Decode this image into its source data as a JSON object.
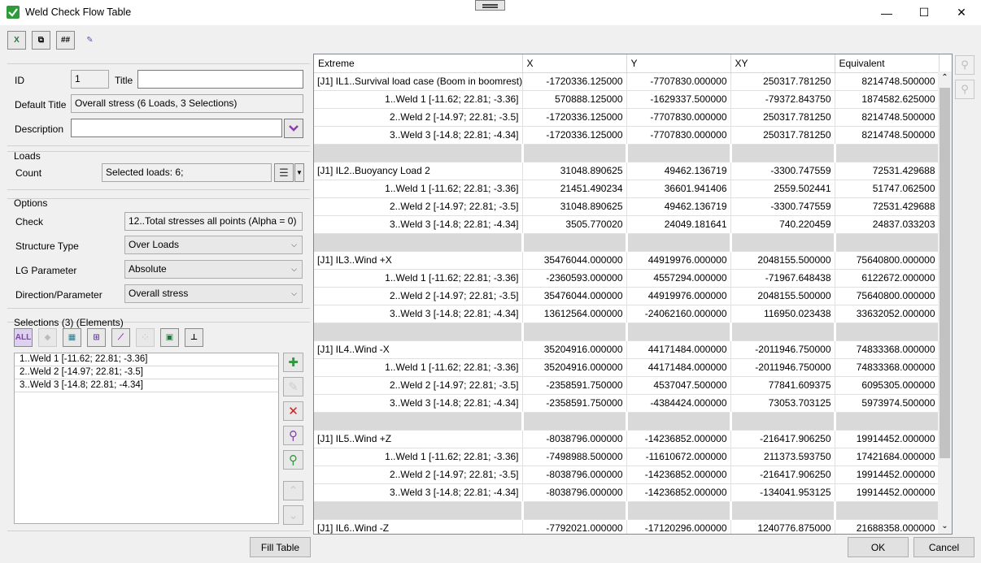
{
  "window": {
    "title": "Weld Check Flow Table",
    "minimize": "—",
    "maximize": "☐",
    "close": "✕"
  },
  "toolbar": {
    "export_label": "X",
    "copy_label": "⧉",
    "number_format_label": "##",
    "clear_label": "✎"
  },
  "form": {
    "id_label": "ID",
    "id_value": "1",
    "title_label": "Title",
    "title_value": "",
    "default_title_label": "Default Title",
    "default_title_value": "Overall stress (6 Loads, 3 Selections)",
    "description_label": "Description",
    "description_value": ""
  },
  "loads": {
    "group_label": "Loads",
    "count_label": "Count",
    "count_value": "Selected loads: 6;"
  },
  "options": {
    "group_label": "Options",
    "check_label": "Check",
    "check_value": "12..Total stresses all points (Alpha = 0)",
    "structure_type_label": "Structure Type",
    "structure_type_value": "Over Loads",
    "lg_parameter_label": "LG Parameter",
    "lg_parameter_value": "Absolute",
    "direction_label": "Direction/Parameter",
    "direction_value": "Overall stress"
  },
  "selections": {
    "group_label": "Selections (3) (Elements)",
    "all_label": "ALL",
    "items": [
      "1..Weld 1 [-11.62; 22.81; -3.36]",
      "2..Weld 2 [-14.97; 22.81; -3.5]",
      "3..Weld 3 [-14.8; 22.81; -4.34]"
    ]
  },
  "buttons": {
    "fill_table": "Fill Table",
    "ok": "OK",
    "cancel": "Cancel"
  },
  "table": {
    "headers": [
      "Extreme",
      "X",
      "Y",
      "XY",
      "Equivalent"
    ],
    "rows": [
      {
        "type": "main",
        "label": "[J1] IL1..Survival load case (Boom in boomrest)",
        "x": "-1720336.125000",
        "y": "-7707830.000000",
        "xy": "250317.781250",
        "eq": "8214748.500000"
      },
      {
        "type": "sub",
        "label": "1..Weld 1 [-11.62; 22.81; -3.36]",
        "x": "570888.125000",
        "y": "-1629337.500000",
        "xy": "-79372.843750",
        "eq": "1874582.625000"
      },
      {
        "type": "sub",
        "label": "2..Weld 2 [-14.97; 22.81; -3.5]",
        "x": "-1720336.125000",
        "y": "-7707830.000000",
        "xy": "250317.781250",
        "eq": "8214748.500000"
      },
      {
        "type": "sub",
        "label": "3..Weld 3 [-14.8; 22.81; -4.34]",
        "x": "-1720336.125000",
        "y": "-7707830.000000",
        "xy": "250317.781250",
        "eq": "8214748.500000"
      },
      {
        "type": "sep"
      },
      {
        "type": "main",
        "label": "[J1] IL2..Buoyancy Load 2",
        "x": "31048.890625",
        "y": "49462.136719",
        "xy": "-3300.747559",
        "eq": "72531.429688"
      },
      {
        "type": "sub",
        "label": "1..Weld 1 [-11.62; 22.81; -3.36]",
        "x": "21451.490234",
        "y": "36601.941406",
        "xy": "2559.502441",
        "eq": "51747.062500"
      },
      {
        "type": "sub",
        "label": "2..Weld 2 [-14.97; 22.81; -3.5]",
        "x": "31048.890625",
        "y": "49462.136719",
        "xy": "-3300.747559",
        "eq": "72531.429688"
      },
      {
        "type": "sub",
        "label": "3..Weld 3 [-14.8; 22.81; -4.34]",
        "x": "3505.770020",
        "y": "24049.181641",
        "xy": "740.220459",
        "eq": "24837.033203"
      },
      {
        "type": "sep"
      },
      {
        "type": "main",
        "label": "[J1] IL3..Wind +X",
        "x": "35476044.000000",
        "y": "44919976.000000",
        "xy": "2048155.500000",
        "eq": "75640800.000000"
      },
      {
        "type": "sub",
        "label": "1..Weld 1 [-11.62; 22.81; -3.36]",
        "x": "-2360593.000000",
        "y": "4557294.000000",
        "xy": "-71967.648438",
        "eq": "6122672.000000"
      },
      {
        "type": "sub",
        "label": "2..Weld 2 [-14.97; 22.81; -3.5]",
        "x": "35476044.000000",
        "y": "44919976.000000",
        "xy": "2048155.500000",
        "eq": "75640800.000000"
      },
      {
        "type": "sub",
        "label": "3..Weld 3 [-14.8; 22.81; -4.34]",
        "x": "13612564.000000",
        "y": "-24062160.000000",
        "xy": "116950.023438",
        "eq": "33632052.000000"
      },
      {
        "type": "sep"
      },
      {
        "type": "main",
        "label": "[J1] IL4..Wind -X",
        "x": "35204916.000000",
        "y": "44171484.000000",
        "xy": "-2011946.750000",
        "eq": "74833368.000000"
      },
      {
        "type": "sub",
        "label": "1..Weld 1 [-11.62; 22.81; -3.36]",
        "x": "35204916.000000",
        "y": "44171484.000000",
        "xy": "-2011946.750000",
        "eq": "74833368.000000"
      },
      {
        "type": "sub",
        "label": "2..Weld 2 [-14.97; 22.81; -3.5]",
        "x": "-2358591.750000",
        "y": "4537047.500000",
        "xy": "77841.609375",
        "eq": "6095305.000000"
      },
      {
        "type": "sub",
        "label": "3..Weld 3 [-14.8; 22.81; -4.34]",
        "x": "-2358591.750000",
        "y": "-4384424.000000",
        "xy": "73053.703125",
        "eq": "5973974.500000"
      },
      {
        "type": "sep"
      },
      {
        "type": "main",
        "label": "[J1] IL5..Wind +Z",
        "x": "-8038796.000000",
        "y": "-14236852.000000",
        "xy": "-216417.906250",
        "eq": "19914452.000000"
      },
      {
        "type": "sub",
        "label": "1..Weld 1 [-11.62; 22.81; -3.36]",
        "x": "-7498988.500000",
        "y": "-11610672.000000",
        "xy": "211373.593750",
        "eq": "17421684.000000"
      },
      {
        "type": "sub",
        "label": "2..Weld 2 [-14.97; 22.81; -3.5]",
        "x": "-8038796.000000",
        "y": "-14236852.000000",
        "xy": "-216417.906250",
        "eq": "19914452.000000"
      },
      {
        "type": "sub",
        "label": "3..Weld 3 [-14.8; 22.81; -4.34]",
        "x": "-8038796.000000",
        "y": "-14236852.000000",
        "xy": "-134041.953125",
        "eq": "19914452.000000"
      },
      {
        "type": "sep"
      },
      {
        "type": "main",
        "label": "[J1] IL6..Wind -Z",
        "x": "-7792021.000000",
        "y": "-17120296.000000",
        "xy": "1240776.875000",
        "eq": "21688358.000000"
      }
    ]
  }
}
